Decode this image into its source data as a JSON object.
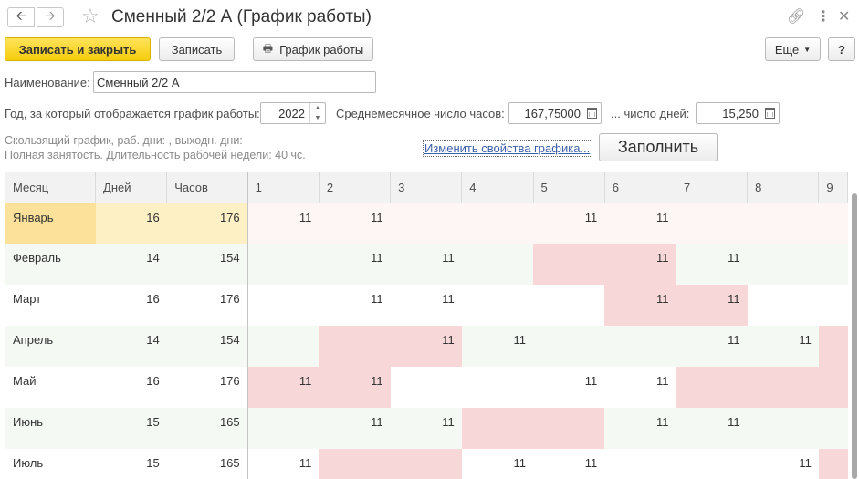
{
  "window": {
    "title": "Сменный 2/2 А (График работы)"
  },
  "toolbar": {
    "save_close_label": "Записать и закрыть",
    "save_label": "Записать",
    "schedule_label": "График работы",
    "more_label": "Еще",
    "help_label": "?"
  },
  "form": {
    "name_label": "Наименование:",
    "name_value": "Сменный 2/2 А",
    "year_label": "Год, за который отображается график работы:",
    "year_value": "2022",
    "avg_hours_label": "Среднемесячное число часов:",
    "avg_hours_value": "167,75000",
    "days_label": "... число дней:",
    "days_value": "15,250",
    "info_line1": "Скользящий график, раб. дни: , выходн. дни:",
    "info_line2": "Полная занятость. Длительность рабочей недели: 40 чс.",
    "change_link": "Изменить свойства графика...",
    "fill_label": "Заполнить"
  },
  "table": {
    "columns": [
      "Месяц",
      "Дней",
      "Часов",
      "1",
      "2",
      "3",
      "4",
      "5",
      "6",
      "7",
      "8",
      "9"
    ],
    "rows": [
      {
        "month": "Январь",
        "days": "16",
        "hours": "176",
        "cells": [
          "11",
          "11",
          "",
          "",
          "11",
          "11",
          "",
          "",
          ""
        ],
        "off": []
      },
      {
        "month": "Февраль",
        "days": "14",
        "hours": "154",
        "cells": [
          "",
          "11",
          "11",
          "",
          "",
          "11",
          "11",
          "",
          ""
        ],
        "off": [
          4,
          5
        ]
      },
      {
        "month": "Март",
        "days": "16",
        "hours": "176",
        "cells": [
          "",
          "11",
          "11",
          "",
          "",
          "11",
          "11",
          "",
          ""
        ],
        "off": [
          5,
          6
        ]
      },
      {
        "month": "Апрель",
        "days": "14",
        "hours": "154",
        "cells": [
          "",
          "",
          "11",
          "11",
          "",
          "",
          "11",
          "11",
          ""
        ],
        "off": [
          1,
          2,
          8
        ]
      },
      {
        "month": "Май",
        "days": "16",
        "hours": "176",
        "cells": [
          "11",
          "11",
          "",
          "",
          "11",
          "11",
          "",
          "",
          ""
        ],
        "off": [
          0,
          1,
          6,
          7,
          8
        ]
      },
      {
        "month": "Июнь",
        "days": "15",
        "hours": "165",
        "cells": [
          "",
          "11",
          "11",
          "",
          "",
          "11",
          "11",
          "",
          ""
        ],
        "off": [
          3,
          4
        ]
      },
      {
        "month": "Июль",
        "days": "15",
        "hours": "165",
        "cells": [
          "11",
          "",
          "",
          "11",
          "11",
          "",
          "",
          "11",
          ""
        ],
        "off": [
          1,
          2,
          8
        ]
      }
    ]
  },
  "colors": {
    "primary_button": "#f6cc0c",
    "weekend_cell": "#f7d7d7",
    "selected_cell": "#fbe199",
    "link": "#3b5fa8"
  }
}
